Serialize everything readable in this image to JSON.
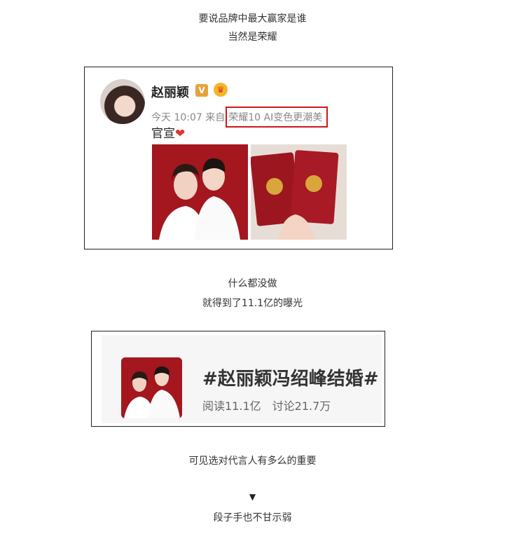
{
  "captions": {
    "line1": "要说品牌中最大赢家是谁",
    "line2": "当然是荣耀",
    "line3": "什么都没做",
    "line4": "就得到了11.1亿的曝光",
    "line5": "可见选对代言人有多么的重要",
    "line6": "段子手也不甘示弱"
  },
  "arrow_glyph": "▼",
  "weibo": {
    "username": "赵丽颖",
    "verified_badge": "V",
    "time": "今天 10:07",
    "from_label": "来自",
    "source": "荣耀10 AI变色更潮美",
    "post_text": "官宣",
    "heart": "❤",
    "highlight_color": "#d0161b"
  },
  "topic": {
    "title": "#赵丽颖冯绍峰结婚#",
    "reads": "阅读11.1亿",
    "discussions": "讨论21.7万"
  }
}
